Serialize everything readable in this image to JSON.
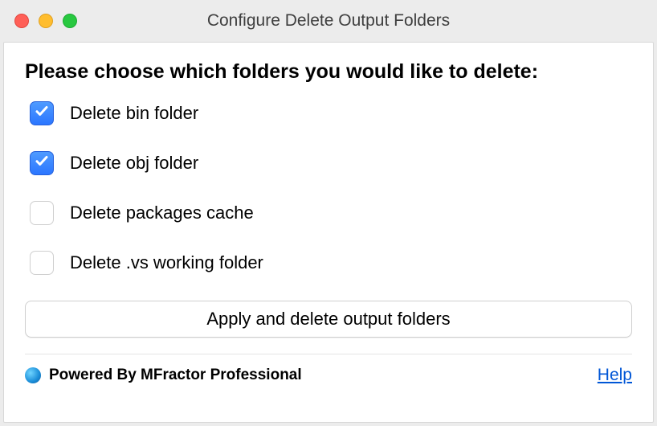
{
  "window": {
    "title": "Configure Delete Output Folders"
  },
  "main": {
    "heading": "Please choose which folders you would like to delete:",
    "options": [
      {
        "label": "Delete bin folder",
        "checked": true
      },
      {
        "label": "Delete obj folder",
        "checked": true
      },
      {
        "label": "Delete packages cache",
        "checked": false
      },
      {
        "label": "Delete .vs working folder",
        "checked": false
      }
    ],
    "apply_label": "Apply and delete output folders"
  },
  "footer": {
    "powered_by": "Powered By MFractor Professional",
    "help_label": "Help"
  }
}
